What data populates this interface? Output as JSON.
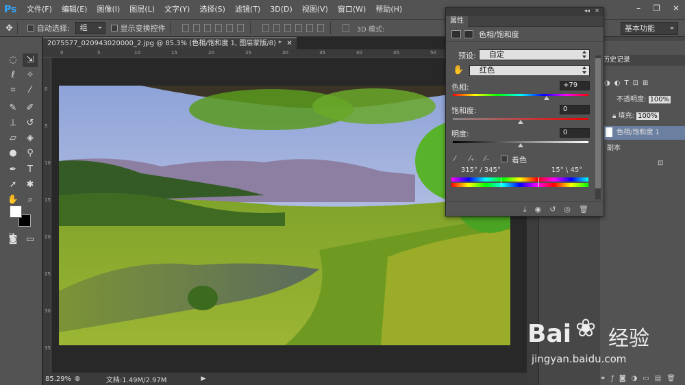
{
  "app": {
    "logo": "Ps"
  },
  "menu": [
    "文件(F)",
    "编辑(E)",
    "图像(I)",
    "图层(L)",
    "文字(Y)",
    "选择(S)",
    "滤镜(T)",
    "3D(D)",
    "视图(V)",
    "窗口(W)",
    "帮助(H)"
  ],
  "window_controls": {
    "minimize": "–",
    "restore": "❐",
    "close": "✕"
  },
  "options": {
    "auto_select_label": "自动选择:",
    "auto_select_value": "组",
    "show_transform_label": "显示变换控件",
    "mode_label": "3D 模式:",
    "workspace": "基本功能"
  },
  "document": {
    "tab_title": "2075577_020943020000_2.jpg @ 85.3% (色相/饱和度 1, 图层蒙版/8) *",
    "ruler_top": [
      "0",
      "5",
      "10",
      "15",
      "20",
      "25",
      "30",
      "35",
      "40",
      "45",
      "50",
      "55",
      "60"
    ],
    "ruler_left": [
      "0",
      "5",
      "10",
      "15",
      "20",
      "25",
      "30",
      "35"
    ]
  },
  "status": {
    "zoom": "85.29%",
    "doc_size": "文档:1.49M/2.97M"
  },
  "properties": {
    "tab": "属性",
    "header": "色相/饱和度",
    "preset_label": "预设:",
    "preset_value": "自定",
    "channel_value": "红色",
    "hue_label": "色相:",
    "hue_value": "+79",
    "hue_level": 0.69,
    "saturation_label": "饱和度:",
    "saturation_value": "0",
    "saturation_level": 0.5,
    "lightness_label": "明度:",
    "lightness_value": "0",
    "lightness_level": 0.5,
    "colorize_label": "着色",
    "range_left": "315° / 345°",
    "range_right": "15° \\ 45°"
  },
  "layers": {
    "tab_history": "历史记录",
    "opacity_label": "不透明度:",
    "opacity_value": "100%",
    "fill_label": "填充:",
    "fill_value": "100%",
    "layer_adjustment": "色相/饱和度 1",
    "layer_copy": "副本"
  },
  "watermark": {
    "brand": "Bai",
    "brand2": "经验",
    "url": "jingyan.baidu.com"
  },
  "colors": {
    "ui_bg": "#535353",
    "dark": "#282828",
    "ps_blue": "#31a8ff"
  }
}
